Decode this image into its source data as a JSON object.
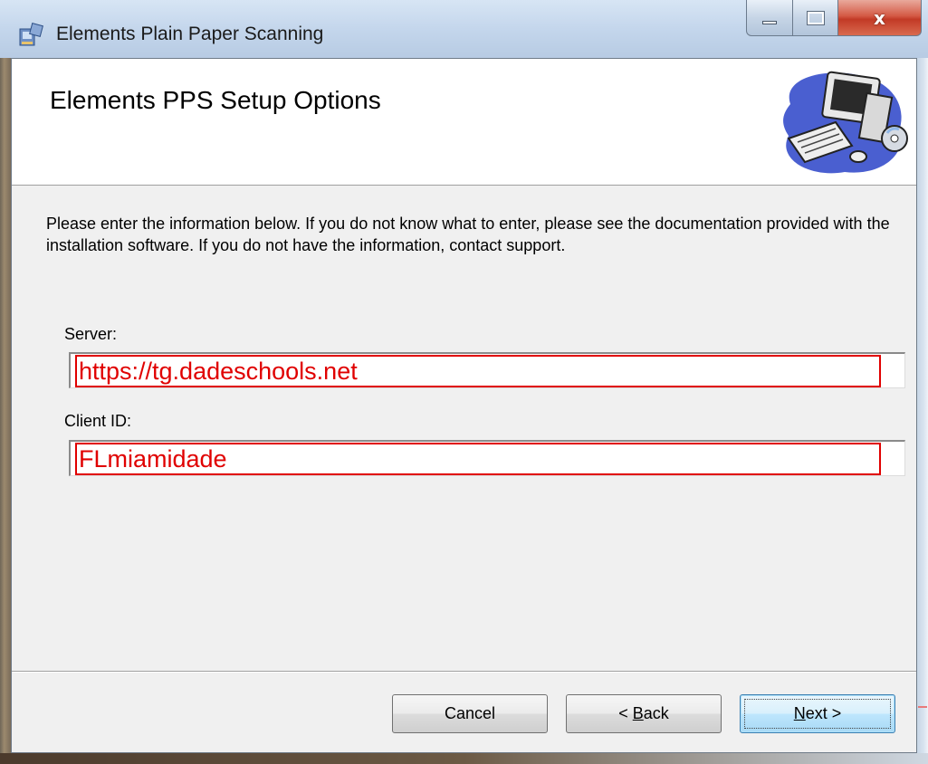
{
  "window": {
    "title": "Elements Plain Paper Scanning",
    "controls": {
      "minimize_icon": "minimize-icon",
      "maximize_icon": "maximize-icon",
      "close_icon": "close-icon",
      "close_glyph": "x"
    }
  },
  "banner": {
    "title": "Elements PPS Setup Options",
    "art_icon": "computer-cd-icon"
  },
  "intro": {
    "text": "Please enter the information below. If you do not know what to enter, please see the documentation provided with the installation software. If you do not have the information, contact support."
  },
  "fields": {
    "server": {
      "label": "Server:",
      "value": "https://tg.dadeschools.net"
    },
    "client_id": {
      "label": "Client ID:",
      "value": "FLmiamidade"
    }
  },
  "buttons": {
    "cancel": "Cancel",
    "back_prefix": "< ",
    "back_accel": "B",
    "back_rest": "ack",
    "next_accel": "N",
    "next_rest": "ext >"
  },
  "colors": {
    "highlight_red": "#e00000",
    "default_button_blue": "#3c7fb1"
  }
}
